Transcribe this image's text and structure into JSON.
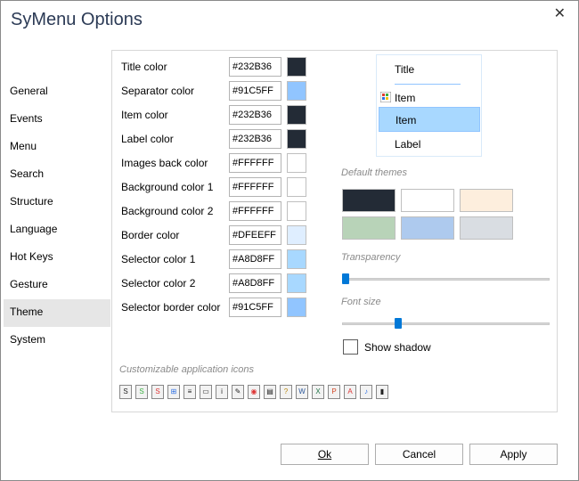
{
  "window": {
    "title": "SyMenu Options"
  },
  "nav": {
    "items": [
      {
        "label": "General"
      },
      {
        "label": "Events"
      },
      {
        "label": "Menu"
      },
      {
        "label": "Search"
      },
      {
        "label": "Structure"
      },
      {
        "label": "Language"
      },
      {
        "label": "Hot Keys"
      },
      {
        "label": "Gesture"
      },
      {
        "label": "Theme",
        "selected": true
      },
      {
        "label": "System"
      }
    ]
  },
  "colors": [
    {
      "label": "Title color",
      "hex": "#232B36"
    },
    {
      "label": "Separator color",
      "hex": "#91C5FF"
    },
    {
      "label": "Item color",
      "hex": "#232B36"
    },
    {
      "label": "Label color",
      "hex": "#232B36"
    },
    {
      "label": "Images back color",
      "hex": "#FFFFFF"
    },
    {
      "label": "Background color 1",
      "hex": "#FFFFFF"
    },
    {
      "label": "Background color 2",
      "hex": "#FFFFFF"
    },
    {
      "label": "Border color",
      "hex": "#DFEEFF"
    },
    {
      "label": "Selector color 1",
      "hex": "#A8D8FF"
    },
    {
      "label": "Selector color 2",
      "hex": "#A8D8FF"
    },
    {
      "label": "Selector border color",
      "hex": "#91C5FF"
    }
  ],
  "preview": {
    "title": "Title",
    "item": "Item",
    "selected_item": "Item",
    "label": "Label"
  },
  "default_themes": {
    "label": "Default themes",
    "swatches": [
      "#232B36",
      "#FFFFFF",
      "#FDEEDD",
      "#B8D3B8",
      "#AECAEE",
      "#D9DDE2"
    ]
  },
  "transparency": {
    "label": "Transparency",
    "value_fraction": 0.0
  },
  "font_size": {
    "label": "Font size",
    "value_fraction": 0.26
  },
  "show_shadow": {
    "label": "Show shadow",
    "checked": false
  },
  "app_icons": {
    "label": "Customizable application icons",
    "items": [
      "symenu-icon",
      "symenu-green-icon",
      "symenu-red-icon",
      "windows-icon",
      "document-icon",
      "folder-icon",
      "info-icon",
      "notepad-icon",
      "chrome-icon",
      "clipboard-icon",
      "help-icon",
      "word-icon",
      "excel-icon",
      "powerpoint-icon",
      "pdf-icon",
      "music-icon",
      "zip-icon"
    ]
  },
  "buttons": {
    "ok": "Ok",
    "cancel": "Cancel",
    "apply": "Apply"
  }
}
